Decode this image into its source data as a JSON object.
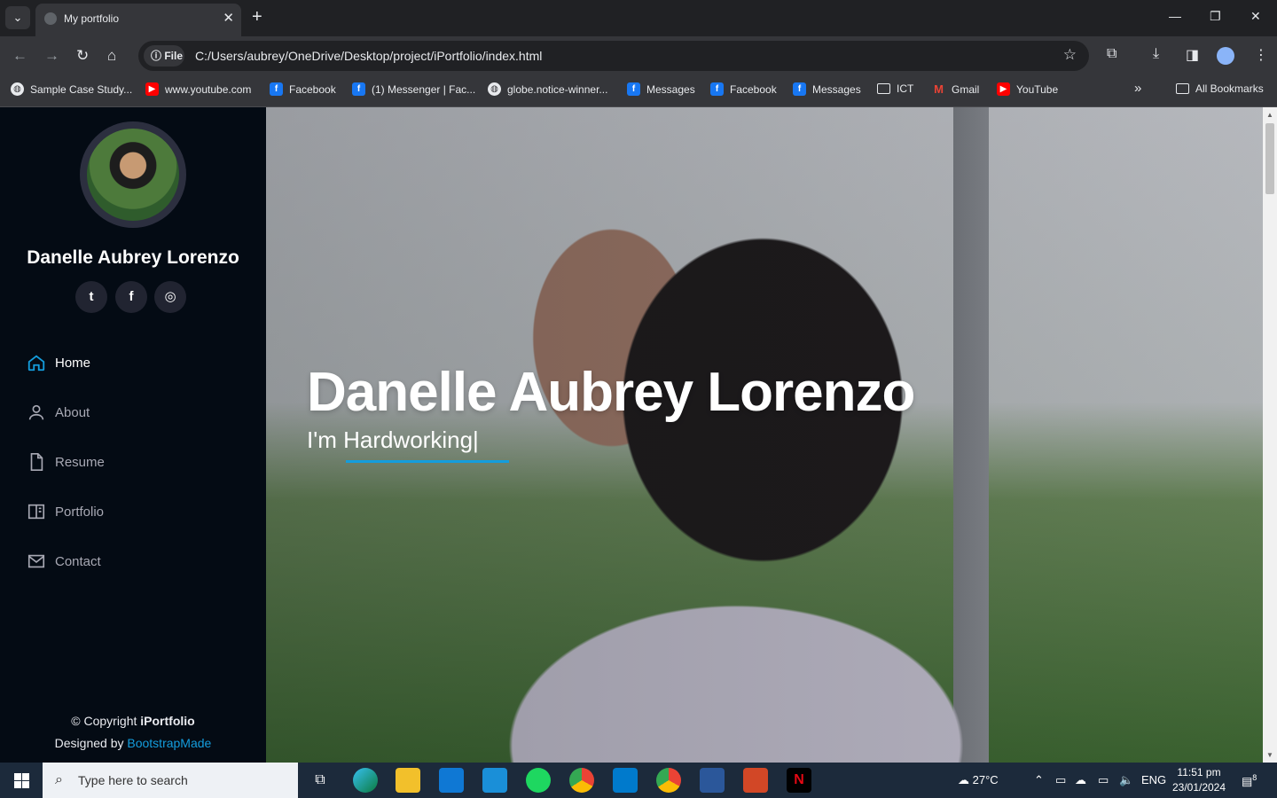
{
  "browser": {
    "tab_title": "My portfolio",
    "url_chip": "File",
    "url": "C:/Users/aubrey/OneDrive/Desktop/project/iPortfolio/index.html",
    "bookmarks": [
      {
        "label": "Sample Case Study...",
        "icon": "globe-icon"
      },
      {
        "label": "www.youtube.com",
        "icon": "youtube-icon"
      },
      {
        "label": "Facebook",
        "icon": "facebook-icon"
      },
      {
        "label": "(1) Messenger | Fac...",
        "icon": "facebook-icon"
      },
      {
        "label": "globe.notice-winner...",
        "icon": "globe-icon"
      },
      {
        "label": "Messages",
        "icon": "facebook-icon"
      },
      {
        "label": "Facebook",
        "icon": "facebook-icon"
      },
      {
        "label": "Messages",
        "icon": "facebook-icon"
      },
      {
        "label": "ICT",
        "icon": "folder-icon"
      },
      {
        "label": "Gmail",
        "icon": "gmail-icon"
      },
      {
        "label": "YouTube",
        "icon": "youtube-icon"
      }
    ],
    "all_bookmarks": "All Bookmarks"
  },
  "sidebar": {
    "name": "Danelle Aubrey Lorenzo",
    "social": [
      {
        "glyph": "t",
        "icon": "twitter-icon"
      },
      {
        "glyph": "f",
        "icon": "facebook-icon"
      },
      {
        "glyph": "◎",
        "icon": "instagram-icon"
      }
    ],
    "nav": [
      {
        "label": "Home",
        "icon": "home-icon",
        "active": true
      },
      {
        "label": "About",
        "icon": "person-icon",
        "active": false
      },
      {
        "label": "Resume",
        "icon": "file-icon",
        "active": false
      },
      {
        "label": "Portfolio",
        "icon": "book-icon",
        "active": false
      },
      {
        "label": "Contact",
        "icon": "envelope-icon",
        "active": false
      }
    ],
    "footer": {
      "copyright_prefix": "© Copyright ",
      "brand": "iPortfolio",
      "designed_prefix": "Designed by ",
      "designer": "BootstrapMade"
    }
  },
  "hero": {
    "title": "Danelle Aubrey Lorenzo",
    "subtitle_prefix": "I'm ",
    "subtitle_typed": "Hardworking|"
  },
  "taskbar": {
    "search_placeholder": "Type here to search",
    "weather": "27°C",
    "language": "ENG",
    "time": "11:51 pm",
    "date": "23/01/2024",
    "notification_count": "8"
  },
  "colors": {
    "accent": "#149ddd",
    "sidebar_bg": "#040b14"
  }
}
